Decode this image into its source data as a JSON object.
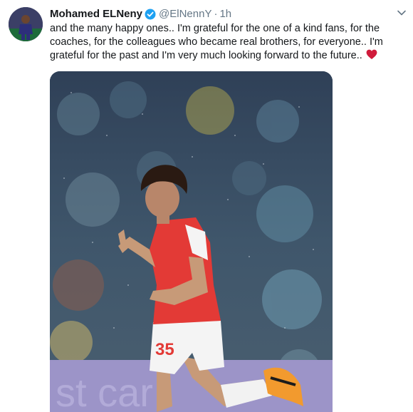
{
  "tweet": {
    "author_name": "Mohamed ELNeny",
    "handle": "@ElNennY",
    "separator": "·",
    "time": "1h",
    "text": "and the many happy ones.. I'm grateful for the one of a kind fans, for the coaches, for the colleagues who became real brothers, for everyone.. I'm grateful for the past and I'm very much looking forward to the future..",
    "emoji": "red-heart-icon",
    "jersey_number": "35"
  },
  "colors": {
    "text": "#14171a",
    "muted": "#657786",
    "verified": "#1da1f2",
    "heart": "#d01b3b",
    "jersey_red": "#e33a36"
  }
}
